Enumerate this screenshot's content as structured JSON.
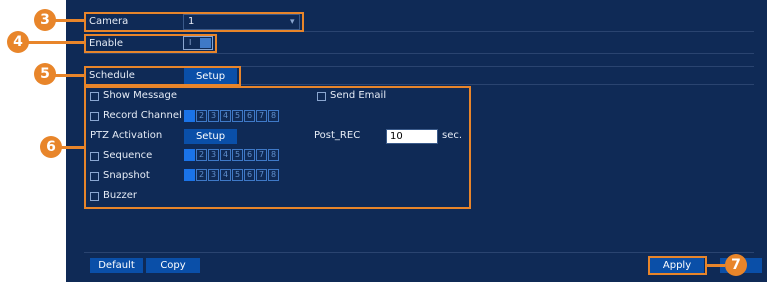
{
  "camera": {
    "label": "Camera",
    "value": "1",
    "arrow": "▾"
  },
  "enable": {
    "label": "Enable",
    "state": "on",
    "toggle_text": "I"
  },
  "schedule": {
    "label": "Schedule",
    "button": "Setup"
  },
  "show_message": {
    "label": "Show Message",
    "checked": false
  },
  "send_email": {
    "label": "Send Email",
    "checked": false
  },
  "record_channel": {
    "label": "Record Channel",
    "checked": false,
    "channels": [
      "1",
      "2",
      "3",
      "4",
      "5",
      "6",
      "7",
      "8"
    ],
    "selected": [
      1
    ]
  },
  "ptz": {
    "label": "PTZ Activation",
    "button": "Setup"
  },
  "post_rec": {
    "label": "Post_REC",
    "value": "10",
    "unit": "sec."
  },
  "sequence": {
    "label": "Sequence",
    "checked": false,
    "channels": [
      "1",
      "2",
      "3",
      "4",
      "5",
      "6",
      "7",
      "8"
    ],
    "selected": [
      1
    ]
  },
  "snapshot": {
    "label": "Snapshot",
    "checked": false,
    "channels": [
      "1",
      "2",
      "3",
      "4",
      "5",
      "6",
      "7",
      "8"
    ],
    "selected": [
      1
    ]
  },
  "buzzer": {
    "label": "Buzzer",
    "checked": false
  },
  "footer": {
    "default": "Default",
    "copy": "Copy",
    "apply": "Apply"
  },
  "callouts": {
    "c3": "3",
    "c4": "4",
    "c5": "5",
    "c6": "6",
    "c7": "7"
  },
  "colors": {
    "panel": "#0f2a56",
    "accent": "#e8852a",
    "button": "#0a4fa8",
    "selected_channel": "#1a73e8"
  }
}
